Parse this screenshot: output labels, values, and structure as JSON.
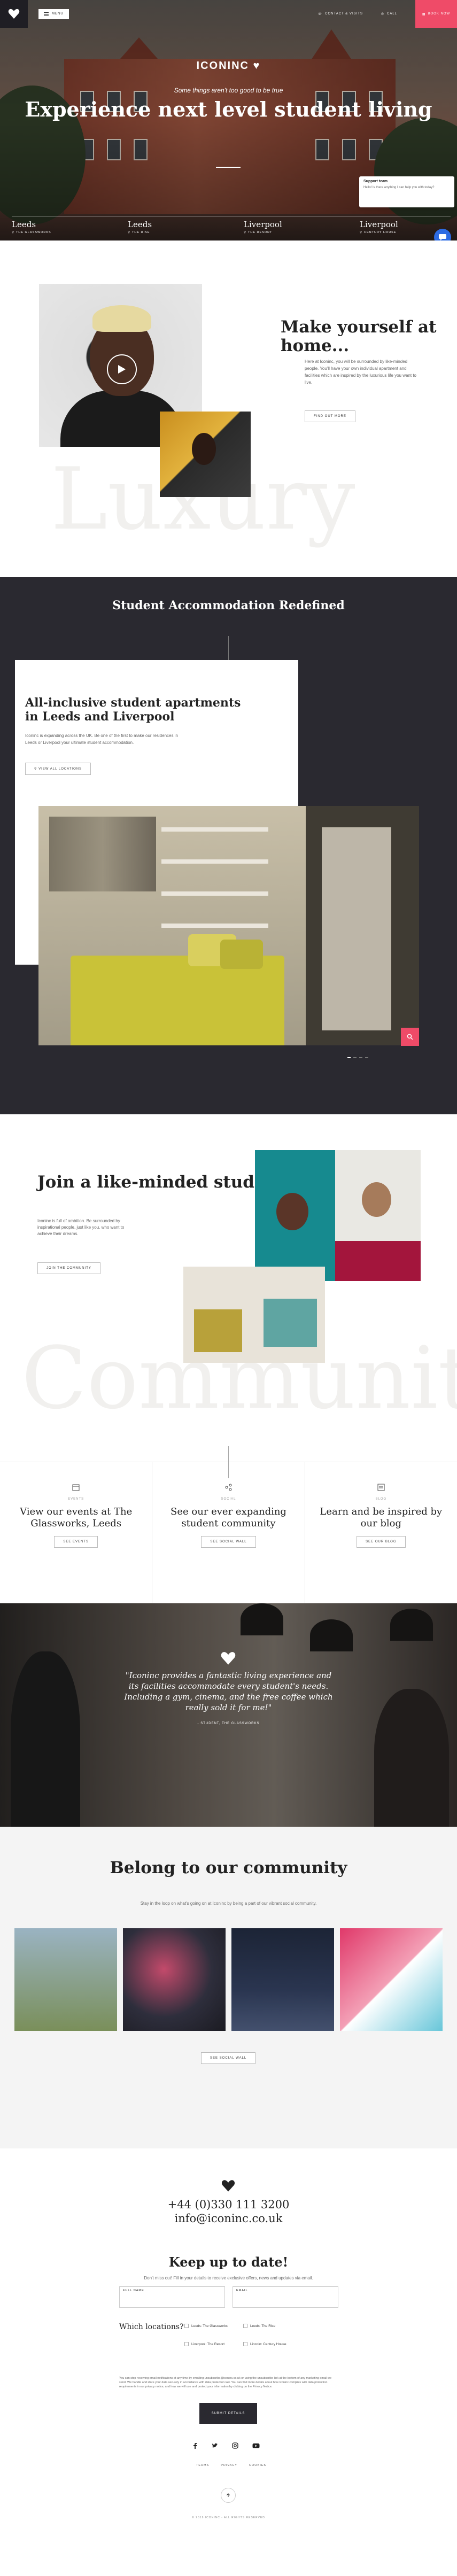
{
  "header": {
    "menu_label": "MENU",
    "contact_label": "CONTACT & VISITS",
    "call_label": "CALL",
    "book_label": "BOOK NOW"
  },
  "hero": {
    "logo": "ICONINC",
    "tagline": "Some things aren't too good to be true",
    "title": "Experience next level student living",
    "cities": [
      {
        "name": "Leeds",
        "sub": "THE GLASSWORKS"
      },
      {
        "name": "Leeds",
        "sub": "THE RISE"
      },
      {
        "name": "Liverpool",
        "sub": "THE RESORT"
      },
      {
        "name": "Liverpool",
        "sub": "CENTURY HOUSE"
      }
    ],
    "support_title": "Support team",
    "support_text": "Hello! Is there anything I can help you with today?"
  },
  "home": {
    "bg_word": "Luxury",
    "title": "Make yourself at home...",
    "text": "Here at Iconinc, you will be surrounded by like-minded people. You'll have your own individual apartment and facilities which are inspired by the luxurious life you want to live.",
    "button": "FIND OUT MORE"
  },
  "accommodation": {
    "title": "Student Accommodation Redefined",
    "card_title": "All-inclusive student apartments in Leeds and Liverpool",
    "card_text": "Iconinc is expanding across the UK. Be one of the first to make our residences in Leeds or Liverpool your ultimate student accommodation.",
    "card_button": "VIEW ALL LOCATIONS"
  },
  "community": {
    "bg_word": "Community",
    "title": "Join a like-minded student community",
    "text": "Iconinc is full of ambition. Be surrounded by inspirational people, just like you, who want to achieve their dreams.",
    "button": "JOIN THE COMMUNITY"
  },
  "features": [
    {
      "label": "EVENTS",
      "title": "View our events at The Glassworks, Leeds",
      "button": "SEE EVENTS"
    },
    {
      "label": "SOCIAL",
      "title": "See our ever expanding student community",
      "button": "SEE SOCIAL WALL"
    },
    {
      "label": "BLOG",
      "title": "Learn and be inspired by our blog",
      "button": "SEE OUR BLOG"
    }
  ],
  "quote": {
    "text": "\"Iconinc provides a fantastic living experience and its facilities accommodate every student's needs. Including a gym, cinema, and the free coffee which really sold it for me!\"",
    "by": "- STUDENT, THE GLASSWORKS"
  },
  "belong": {
    "title": "Belong to our community",
    "text": "Stay in the loop on what's going on at Iconinc by being a part of our vibrant social community.",
    "button": "SEE SOCIAL WALL"
  },
  "footer": {
    "phone": "+44 (0)330 111 3200",
    "email": "info@iconinc.co.uk",
    "keep_title": "Keep up to date!",
    "keep_text": "Don't miss out! Fill in your details to receive exclusive offers, news and updates via email.",
    "full_name_label": "FULL NAME",
    "email_label": "EMAIL",
    "locations_label": "Which locations?",
    "locations": [
      "Leeds: The Glassworks",
      "Leeds: The Rise",
      "Liverpool: The Resort",
      "Lincoln: Century House"
    ],
    "legal": "You can stop receiving email notifications at any time by emailing unsubscribe@iconinc.co.uk or using the unsubscribe link at the bottom of any marketing email we send. We handle and store your data securely in accordance with data protection law. You can find more details about how Iconinc complies with data protection requirements in our privacy notice, and how we will use and protect your information by clicking on the Privacy Notice.",
    "submit": "SUBMIT DETAILS",
    "links": [
      "TERMS",
      "PRIVACY",
      "COOKIES"
    ],
    "copyright": "© 2019 ICONINC - ALL RIGHTS RESERVED"
  },
  "colors": {
    "accent": "#ef4b68",
    "dark": "#2a2930",
    "chat": "#2d6be3"
  },
  "icons": [
    "heart-logo-icon",
    "hamburger-icon",
    "phone-icon",
    "location-pin-icon",
    "play-icon",
    "arrow-up-icon",
    "facebook-icon",
    "twitter-icon",
    "instagram-icon",
    "youtube-icon",
    "chat-icon"
  ]
}
